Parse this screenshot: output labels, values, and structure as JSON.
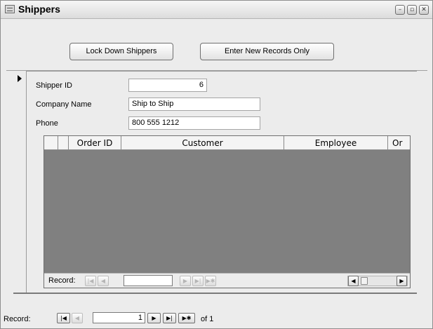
{
  "window": {
    "title": "Shippers",
    "controls": {
      "minimize": "–",
      "restore": "▫",
      "close": "✕"
    }
  },
  "buttons": {
    "lock_down": "Lock Down Shippers",
    "new_records": "Enter New Records Only"
  },
  "fields": {
    "shipper_id": {
      "label": "Shipper ID",
      "value": "6"
    },
    "company_name": {
      "label": "Company Name",
      "value": "Ship to Ship"
    },
    "phone": {
      "label": "Phone",
      "value": "800 555 1212"
    }
  },
  "subform": {
    "columns": [
      "",
      "",
      "Order ID",
      "Customer",
      "Employee",
      "Or"
    ],
    "nav": {
      "label": "Record:",
      "current": "",
      "first": "|◀",
      "prev": "◀",
      "next": "▶",
      "last": "▶|",
      "new": "▶✱"
    },
    "scroll_left": "◀",
    "scroll_right": "▶"
  },
  "record_nav": {
    "label": "Record:",
    "current": "1",
    "total": "of 1",
    "first": "|◀",
    "prev": "◀",
    "next": "▶",
    "last": "▶|",
    "new": "▶✱"
  },
  "icons": {
    "form": "form-icon",
    "record_selector": "current-record-triangle-icon"
  },
  "colors": {
    "window_bg": "#ececec",
    "subform_body": "#808080"
  }
}
